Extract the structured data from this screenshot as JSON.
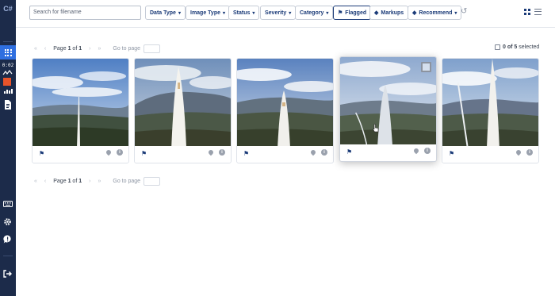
{
  "sidebar": {
    "logo": "C#",
    "timer": "0:02"
  },
  "toolbar": {
    "search_placeholder": "Search for filename",
    "filters": [
      {
        "label": "Data Type",
        "chevron": "▾"
      },
      {
        "label": "Image Type",
        "chevron": "▾"
      },
      {
        "label": "Status",
        "chevron": "▾"
      },
      {
        "label": "Severity",
        "chevron": "▾"
      },
      {
        "label": "Category",
        "chevron": "▾"
      },
      {
        "label": "Flagged",
        "icon": "⚑"
      },
      {
        "label": "Markups",
        "icon": "◆"
      },
      {
        "label": "Recommend",
        "icon": "◆",
        "chevron": "▾"
      }
    ],
    "refresh_icon": "↺"
  },
  "pager_top": {
    "first": "«",
    "prev": "‹",
    "page_word": "Page",
    "page": "1",
    "of_word": "of",
    "total": "1",
    "next": "›",
    "last": "»",
    "goto_label": "Go to page"
  },
  "pager_bottom": {
    "first": "«",
    "prev": "‹",
    "page_word": "Page",
    "page": "1",
    "of_word": "of",
    "total": "1",
    "next": "›",
    "last": "»",
    "goto_label": "Go to page"
  },
  "selection": {
    "count": "0 of 5",
    "suffix": "selected"
  },
  "cards": [
    {
      "flag": "⚑",
      "info": "i"
    },
    {
      "flag": "⚑",
      "info": "i"
    },
    {
      "flag": "⚑",
      "info": "i"
    },
    {
      "flag": "⚑",
      "info": "i"
    },
    {
      "flag": "⚑",
      "info": "i"
    }
  ],
  "colors": {
    "sidebar_bg": "#1c2b4a",
    "accent": "#2f6fe0",
    "navy": "#1b3b78",
    "alert": "#e8542a"
  }
}
